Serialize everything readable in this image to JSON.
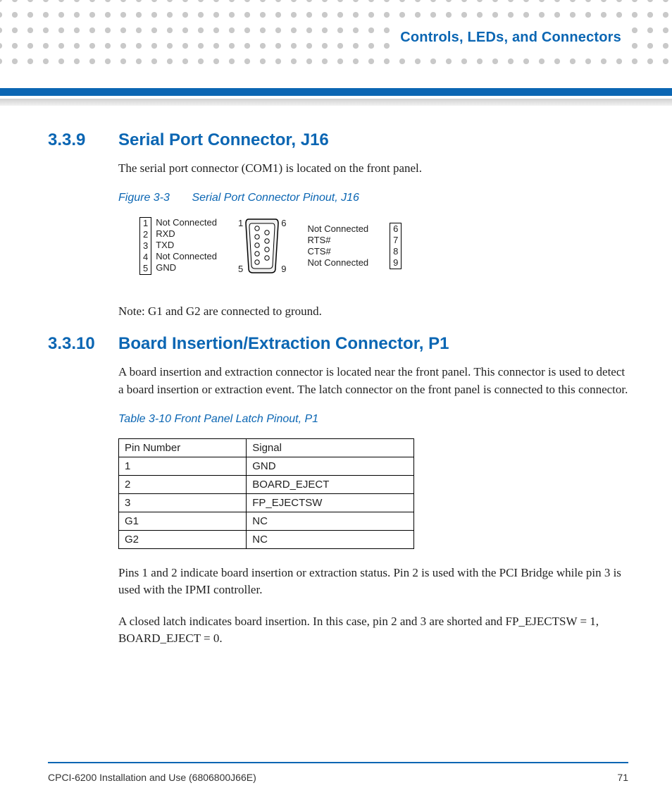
{
  "header": {
    "chapter_title": "Controls, LEDs, and Connectors"
  },
  "section1": {
    "number": "3.3.9",
    "title": "Serial Port Connector, J16",
    "intro": "The serial port connector (COM1) is located on the front panel.",
    "figure_label": "Figure 3-3",
    "figure_title": "Serial Port Connector Pinout, J16",
    "note": "Note: G1 and G2 are connected to ground.",
    "left_pins": [
      "1",
      "2",
      "3",
      "4",
      "5"
    ],
    "left_labels": [
      "Not Connected",
      "RXD",
      "TXD",
      "Not Connected",
      "GND"
    ],
    "db9_left_top": "1",
    "db9_left_bottom": "5",
    "db9_right_top": "6",
    "db9_right_bottom": "9",
    "right_labels": [
      "Not Connected",
      "RTS#",
      "CTS#",
      "Not Connected"
    ],
    "right_pins": [
      "6",
      "7",
      "8",
      "9"
    ]
  },
  "section2": {
    "number": "3.3.10",
    "title": "Board Insertion/Extraction Connector, P1",
    "intro": "A board insertion and extraction connector is located near the front panel. This connector is used to detect a board insertion or extraction event. The latch connector on the front panel is connected to this connector.",
    "table_label": "Table 3-10 Front Panel Latch Pinout, P1",
    "table_head_col1": "Pin Number",
    "table_head_col2": "Signal",
    "rows": [
      {
        "pin": "1",
        "sig": "GND"
      },
      {
        "pin": "2",
        "sig": "BOARD_EJECT"
      },
      {
        "pin": "3",
        "sig": "FP_EJECTSW"
      },
      {
        "pin": "G1",
        "sig": "NC"
      },
      {
        "pin": "G2",
        "sig": "NC"
      }
    ],
    "para2": "Pins 1 and 2 indicate board insertion or extraction status. Pin 2 is used with the PCI Bridge while pin 3 is used with the IPMI controller.",
    "para3": "A closed latch indicates board insertion. In this case, pin 2 and 3 are shorted and FP_EJECTSW = 1, BOARD_EJECT = 0."
  },
  "footer": {
    "doc": "CPCI-6200 Installation and Use (6806800J66E)",
    "page": "71"
  }
}
